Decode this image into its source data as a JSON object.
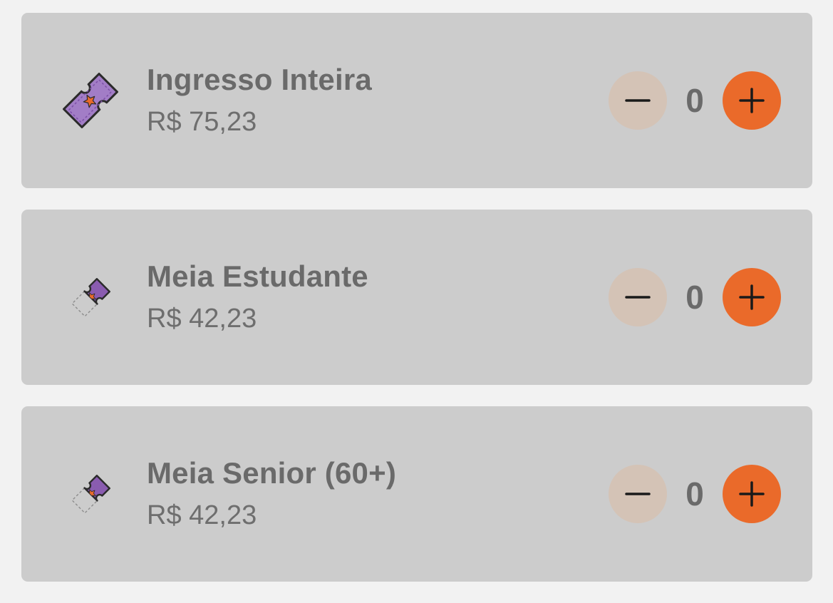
{
  "tickets": [
    {
      "name": "Ingresso Inteira",
      "price": "R$ 75,23",
      "quantity": "0",
      "icon": "full-ticket-icon"
    },
    {
      "name": "Meia Estudante",
      "price": "R$ 42,23",
      "quantity": "0",
      "icon": "half-ticket-icon"
    },
    {
      "name": "Meia Senior (60+)",
      "price": "R$ 42,23",
      "quantity": "0",
      "icon": "half-ticket-icon"
    }
  ],
  "colors": {
    "background": "#f2f2f2",
    "card": "#cccccc",
    "minus_button": "#d4c3b6",
    "plus_button": "#ea6a2a",
    "ticket_purple": "#8a5cb0",
    "star_orange": "#ea6a2a",
    "text": "#6a6a6a"
  },
  "icons": {
    "minus": "minus-icon",
    "plus": "plus-icon"
  }
}
